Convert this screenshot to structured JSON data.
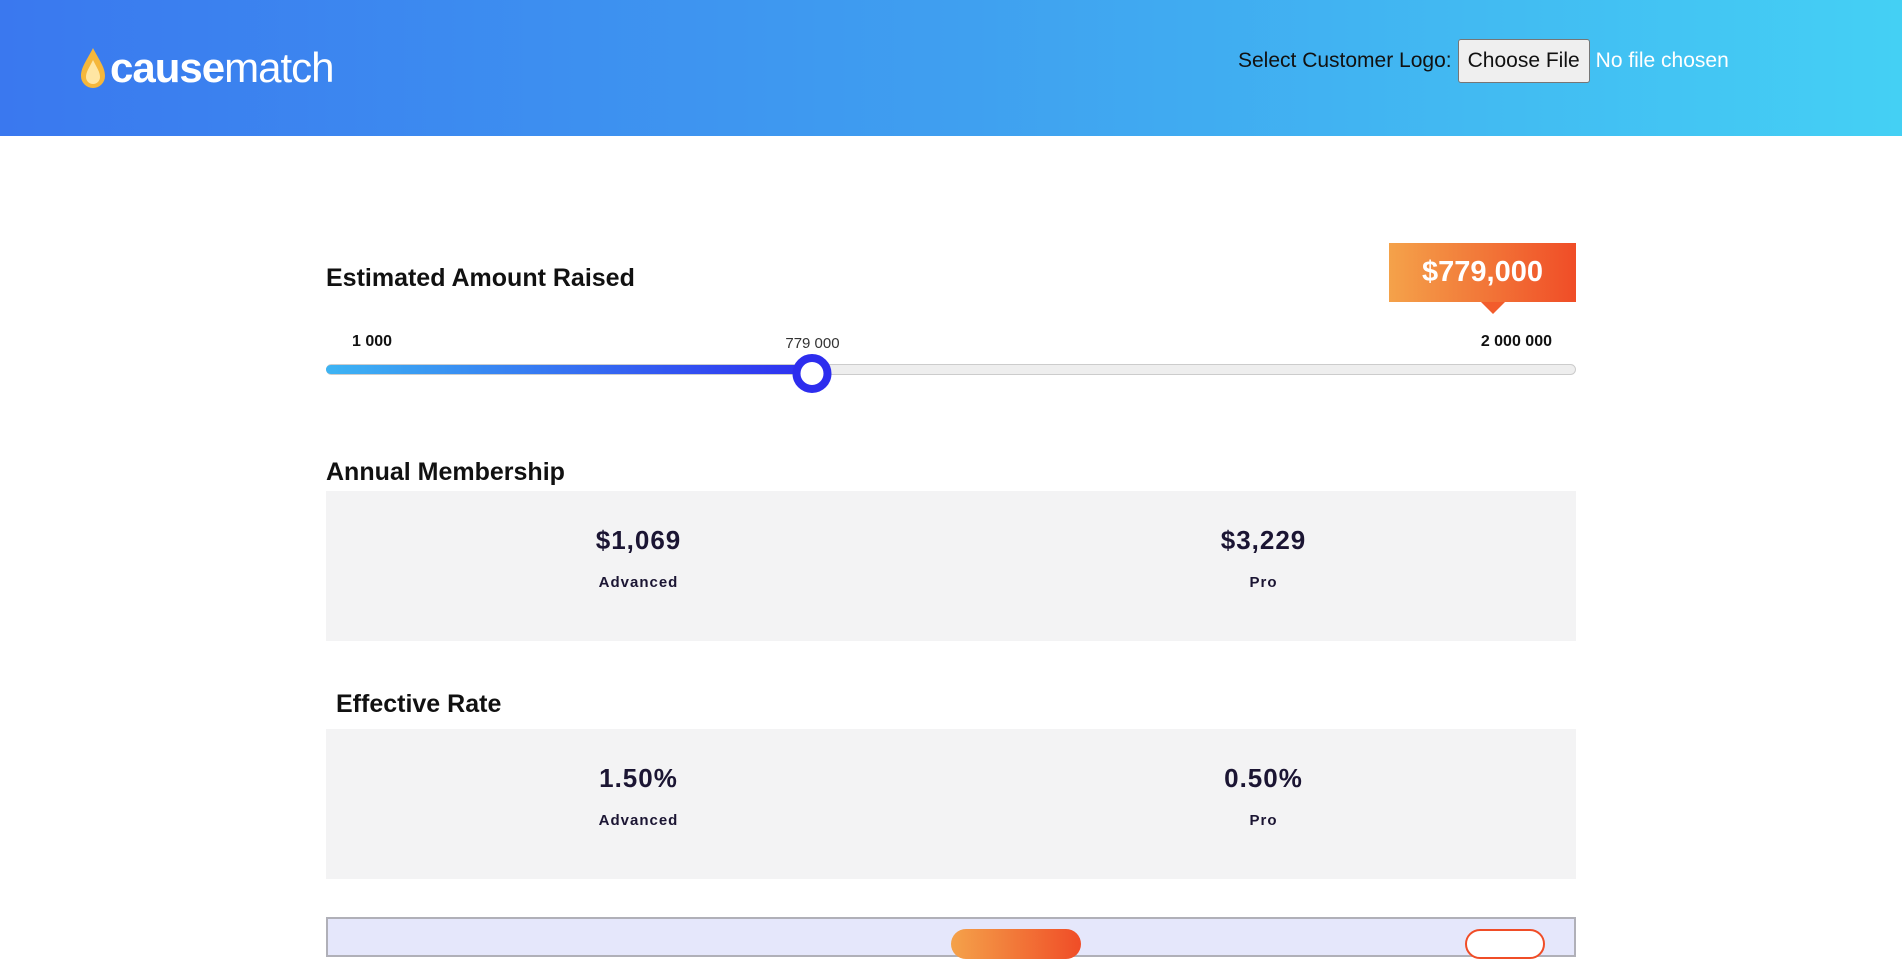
{
  "header": {
    "logo": {
      "part1": "cause",
      "part2": "match"
    },
    "upload_label": "Select Customer Logo:",
    "choose_button": "Choose File",
    "file_status": "No file chosen"
  },
  "amount": {
    "title": "Estimated Amount Raised",
    "badge": "$779,000",
    "slider": {
      "min_label": "1 000",
      "max_label": "2 000 000",
      "current_label": "779 000",
      "min": 1000,
      "max": 2000000,
      "value": 779000
    }
  },
  "membership": {
    "title": "Annual Membership",
    "plans": [
      {
        "value": "$1,069",
        "label": "Advanced"
      },
      {
        "value": "$3,229",
        "label": "Pro"
      }
    ]
  },
  "rate": {
    "title": "Effective Rate",
    "plans": [
      {
        "value": "1.50%",
        "label": "Advanced"
      },
      {
        "value": "0.50%",
        "label": "Pro"
      }
    ]
  },
  "colors": {
    "header_gradient_start": "#3a78ef",
    "header_gradient_end": "#44d0f4",
    "accent_orange": "#f4a24a",
    "accent_red": "#f04d27",
    "slider_blue": "#2d2dee",
    "card_background": "#f3f3f4"
  },
  "icons": {
    "logo_mark": "flame-drop-icon"
  }
}
